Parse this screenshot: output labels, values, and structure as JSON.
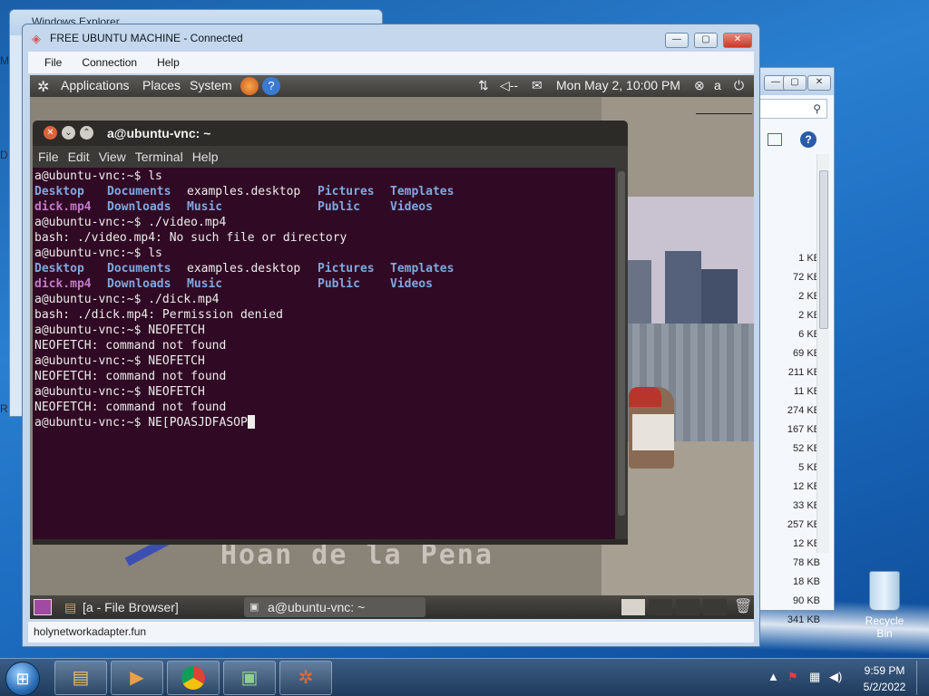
{
  "desktop": {
    "left_edge_letters": [
      "M",
      "D",
      "R"
    ],
    "recycle_bin_label": "Recycle Bin"
  },
  "back_window_left": {
    "title": "Windows Explorer"
  },
  "back_window_right": {
    "sizes": [
      "1 KB",
      "72 KB",
      "2 KB",
      "2 KB",
      "6 KB",
      "69 KB",
      "211 KB",
      "11 KB",
      "274 KB",
      "167 KB",
      "52 KB",
      "5 KB",
      "12 KB",
      "33 KB",
      "257 KB",
      "12 KB",
      "78 KB",
      "18 KB",
      "90 KB",
      "341 KB"
    ]
  },
  "vnc": {
    "title": "FREE UBUNTU MACHINE - Connected",
    "menu": [
      "File",
      "Connection",
      "Help"
    ],
    "status_url": "holynetworkadapter.fun",
    "controls": {
      "minimize": "—",
      "maximize": "▢",
      "close": "✕"
    }
  },
  "ubuntu": {
    "top_panel": {
      "menus": [
        "Applications",
        "Places",
        "System"
      ],
      "datetime": "Mon May  2, 10:00 PM",
      "user": "a"
    },
    "bottom_panel": {
      "tasks": [
        "[a - File Browser]",
        "a@ubuntu-vnc: ~"
      ]
    },
    "scene_text": "Hoan de la Pena"
  },
  "terminal": {
    "title": "a@ubuntu-vnc: ~",
    "menu": [
      "File",
      "Edit",
      "View",
      "Terminal",
      "Help"
    ],
    "lines": [
      {
        "type": "text",
        "text": "a@ubuntu-vnc:~$ ls"
      },
      {
        "type": "cols",
        "cols": [
          {
            "t": "Desktop",
            "c": "blue"
          },
          {
            "t": "Documents",
            "c": "blue"
          },
          {
            "t": "examples.desktop",
            "c": ""
          },
          {
            "t": "Pictures",
            "c": "blue"
          },
          {
            "t": "Templates",
            "c": "blue"
          }
        ]
      },
      {
        "type": "cols",
        "cols": [
          {
            "t": "dick.mp4",
            "c": "mag"
          },
          {
            "t": "Downloads",
            "c": "blue"
          },
          {
            "t": "Music",
            "c": "blue"
          },
          {
            "t": "Public",
            "c": "blue"
          },
          {
            "t": "Videos",
            "c": "blue"
          }
        ]
      },
      {
        "type": "text",
        "text": "a@ubuntu-vnc:~$ ./video.mp4"
      },
      {
        "type": "text",
        "text": "bash: ./video.mp4: No such file or directory"
      },
      {
        "type": "text",
        "text": "a@ubuntu-vnc:~$ ls"
      },
      {
        "type": "cols",
        "cols": [
          {
            "t": "Desktop",
            "c": "blue"
          },
          {
            "t": "Documents",
            "c": "blue"
          },
          {
            "t": "examples.desktop",
            "c": ""
          },
          {
            "t": "Pictures",
            "c": "blue"
          },
          {
            "t": "Templates",
            "c": "blue"
          }
        ]
      },
      {
        "type": "cols",
        "cols": [
          {
            "t": "dick.mp4",
            "c": "mag"
          },
          {
            "t": "Downloads",
            "c": "blue"
          },
          {
            "t": "Music",
            "c": "blue"
          },
          {
            "t": "Public",
            "c": "blue"
          },
          {
            "t": "Videos",
            "c": "blue"
          }
        ]
      },
      {
        "type": "text",
        "text": "a@ubuntu-vnc:~$ ./dick.mp4"
      },
      {
        "type": "text",
        "text": "bash: ./dick.mp4: Permission denied"
      },
      {
        "type": "text",
        "text": "a@ubuntu-vnc:~$ NEOFETCH"
      },
      {
        "type": "text",
        "text": "NEOFETCH: command not found"
      },
      {
        "type": "text",
        "text": "a@ubuntu-vnc:~$ NEOFETCH"
      },
      {
        "type": "text",
        "text": "NEOFETCH: command not found"
      },
      {
        "type": "text",
        "text": "a@ubuntu-vnc:~$ NEOFETCH"
      },
      {
        "type": "text",
        "text": "NEOFETCH: command not found"
      },
      {
        "type": "prompt",
        "text": "a@ubuntu-vnc:~$ NE[POASJDFASOP"
      }
    ]
  },
  "taskbar": {
    "time": "9:59 PM",
    "date": "5/2/2022"
  },
  "colors": {
    "terminal_bg": "#300a24",
    "dir_blue": "#7fa8e0",
    "media_magenta": "#c07ac6"
  }
}
